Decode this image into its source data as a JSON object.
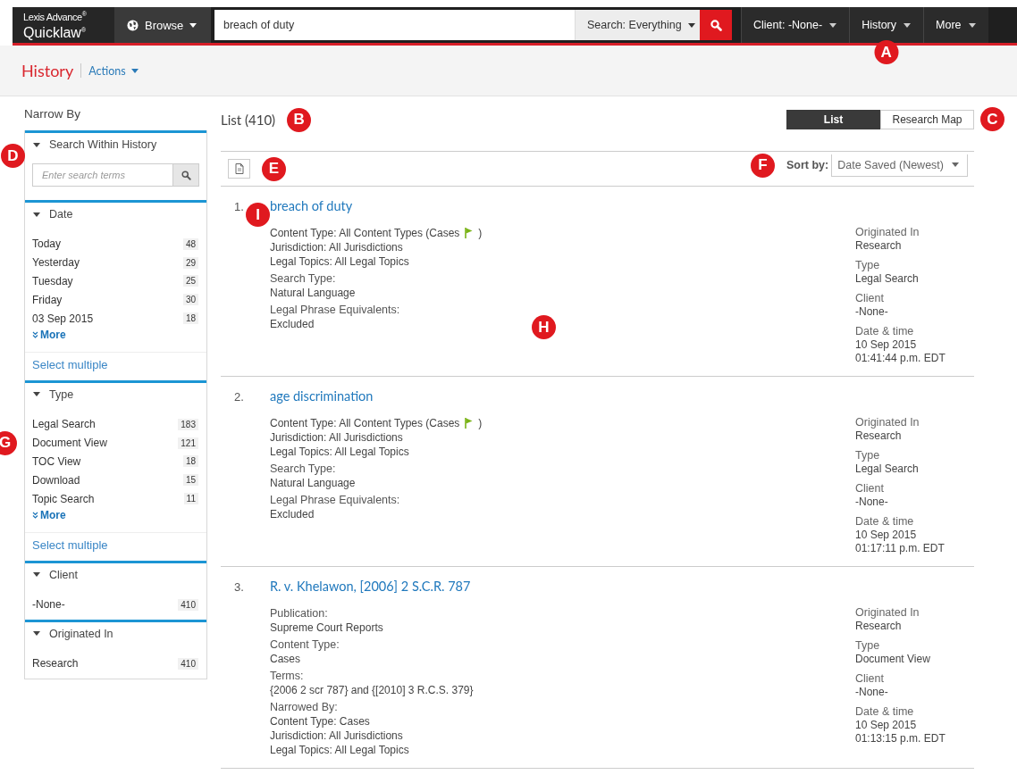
{
  "topbar": {
    "logo_line1": "Lexis Advance$^{®}$",
    "logo_line2": "Quicklaw$^{®}$",
    "browse": "Browse",
    "search_value": "breach of duty",
    "search_scope": "Search: Everything",
    "nav": [
      {
        "label": "Client: -None-"
      },
      {
        "label": "History",
        "callout": "A"
      },
      {
        "label": "More"
      }
    ]
  },
  "header": {
    "title": "History",
    "actions": "Actions"
  },
  "narrow_by": {
    "title": "Narrow By",
    "sections": [
      {
        "title": "Search Within History",
        "kind": "search",
        "expanded": true,
        "callout": "D",
        "placeholder": "Enter search terms"
      },
      {
        "title": "Date",
        "kind": "list",
        "expanded": true,
        "items": [
          {
            "label": "Today",
            "count": "48"
          },
          {
            "label": "Yesterday",
            "count": "29"
          },
          {
            "label": "Tuesday",
            "count": "25"
          },
          {
            "label": "Friday",
            "count": "30"
          },
          {
            "label": "03 Sep 2015",
            "count": "18"
          }
        ],
        "more": "More",
        "select_multiple": "Select multiple"
      },
      {
        "title": "Type",
        "kind": "list",
        "expanded": true,
        "items": [
          {
            "label": "Legal Search",
            "count": "183"
          },
          {
            "label": "Document View",
            "count": "121",
            "callout": "G"
          },
          {
            "label": "TOC View",
            "count": "18"
          },
          {
            "label": "Download",
            "count": "15"
          },
          {
            "label": "Topic Search",
            "count": "11"
          }
        ],
        "more": "More",
        "select_multiple": "Select multiple"
      },
      {
        "title": "Client",
        "kind": "list",
        "expanded": true,
        "items": [
          {
            "label": "-None-",
            "count": "410"
          }
        ]
      },
      {
        "title": "Originated In",
        "kind": "list",
        "expanded": true,
        "items": [
          {
            "label": "Research",
            "count": "410"
          }
        ]
      }
    ]
  },
  "list": {
    "title": "List (410)",
    "title_callout": "B",
    "views": [
      {
        "label": "List",
        "selected": true
      },
      {
        "label": "Research Map",
        "selected": false
      }
    ],
    "views_callout": "C",
    "export_callout": "E",
    "sort_label": "Sort by:",
    "sort_value": "Date Saved (Newest)",
    "sort_callout": "F",
    "results": [
      {
        "number": "1.",
        "number_callout": "I",
        "title": "breach of duty",
        "body_callout": "H",
        "details": [
          {
            "lines": [
              {
                "text": "Content Type: All Content Types (Cases",
                "flag": true,
                "suffix": ")"
              },
              {
                "text": "Jurisdiction: All Jurisdictions"
              },
              {
                "text": "Legal Topics: All Legal Topics"
              }
            ]
          },
          {
            "heading": "Search Type:",
            "lines": [
              {
                "text": "Natural Language"
              }
            ]
          },
          {
            "heading": "Legal Phrase Equivalents:",
            "lines": [
              {
                "text": "Excluded"
              }
            ]
          }
        ],
        "meta": [
          {
            "label": "Originated In",
            "values": [
              "Research"
            ]
          },
          {
            "label": "Type",
            "values": [
              "Legal Search"
            ]
          },
          {
            "label": "Client",
            "values": [
              "-None-"
            ]
          },
          {
            "label": "Date & time",
            "values": [
              "10 Sep 2015",
              "01:41:44 p.m. EDT"
            ]
          }
        ]
      },
      {
        "number": "2.",
        "title": "age discrimination",
        "details": [
          {
            "lines": [
              {
                "text": "Content Type: All Content Types (Cases",
                "flag": true,
                "suffix": ")"
              },
              {
                "text": "Jurisdiction: All Jurisdictions"
              },
              {
                "text": "Legal Topics: All Legal Topics"
              }
            ]
          },
          {
            "heading": "Search Type:",
            "lines": [
              {
                "text": "Natural Language"
              }
            ]
          },
          {
            "heading": "Legal Phrase Equivalents:",
            "lines": [
              {
                "text": "Excluded"
              }
            ]
          }
        ],
        "meta": [
          {
            "label": "Originated In",
            "values": [
              "Research"
            ]
          },
          {
            "label": "Type",
            "values": [
              "Legal Search"
            ]
          },
          {
            "label": "Client",
            "values": [
              "-None-"
            ]
          },
          {
            "label": "Date & time",
            "values": [
              "10 Sep 2015",
              "01:17:11 p.m. EDT"
            ]
          }
        ]
      },
      {
        "number": "3.",
        "title": "R. v. Khelawon, [2006] 2 S.C.R. 787",
        "details": [
          {
            "heading": "Publication:",
            "lines": [
              {
                "text": "Supreme Court Reports"
              }
            ]
          },
          {
            "heading": "Content Type:",
            "lines": [
              {
                "text": "Cases"
              }
            ]
          },
          {
            "heading": "Terms:",
            "lines": [
              {
                "text": "{2006 2 scr 787} and {[2010] 3 R.C.S. 379}"
              }
            ]
          },
          {
            "heading": "Narrowed By:",
            "lines": [
              {
                "text": "Content Type: Cases"
              },
              {
                "text": "Jurisdiction: All Jurisdictions"
              },
              {
                "text": "Legal Topics: All Legal Topics"
              }
            ]
          }
        ],
        "meta": [
          {
            "label": "Originated In",
            "values": [
              "Research"
            ]
          },
          {
            "label": "Type",
            "values": [
              "Document View"
            ]
          },
          {
            "label": "Client",
            "values": [
              "-None-"
            ]
          },
          {
            "label": "Date & time",
            "values": [
              "10 Sep 2015",
              "01:13:15 p.m. EDT"
            ]
          }
        ]
      }
    ]
  }
}
